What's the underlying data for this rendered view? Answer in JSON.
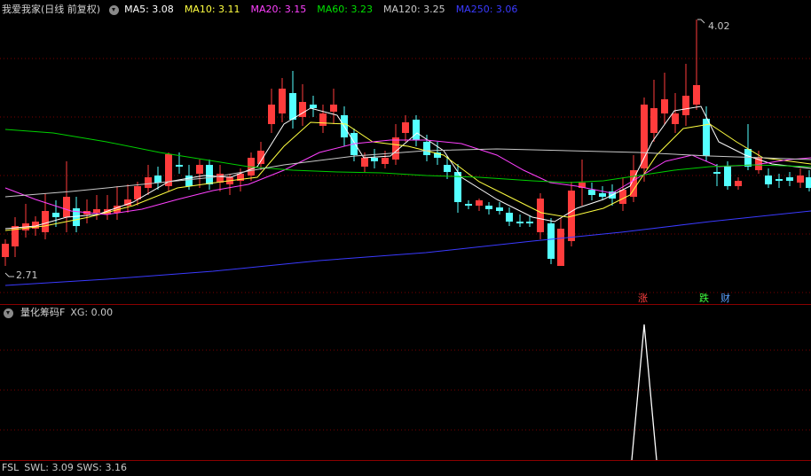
{
  "main_panel": {
    "title": "我爱我家(日线 前复权)",
    "indicators": [
      {
        "label": "MA5: 3.08",
        "color": "#ffffff"
      },
      {
        "label": "MA10: 3.11",
        "color": "#ffff40"
      },
      {
        "label": "MA20: 3.15",
        "color": "#ff40ff"
      },
      {
        "label": "MA60: 3.23",
        "color": "#00e000"
      },
      {
        "label": "MA120: 3.25",
        "color": "#c8c8c8"
      },
      {
        "label": "MA250: 3.06",
        "color": "#3a3aff"
      }
    ],
    "high_label": "4.02",
    "low_label": "2.71",
    "tags": [
      {
        "text": "涨",
        "color": "#ff4040"
      },
      {
        "text": "跌",
        "color": "#40ff40"
      },
      {
        "text": "财",
        "color": "#5aa0ff"
      }
    ]
  },
  "sub_panel": {
    "title": "量化筹码F",
    "value_label": "XG: 0.00"
  },
  "bottom_panel": {
    "title": "FSL",
    "text": "SWL: 3.09  SWS: 3.16"
  },
  "colors": {
    "up": "#ff3c3c",
    "down": "#54ffff",
    "grid": "#7a0000"
  }
}
